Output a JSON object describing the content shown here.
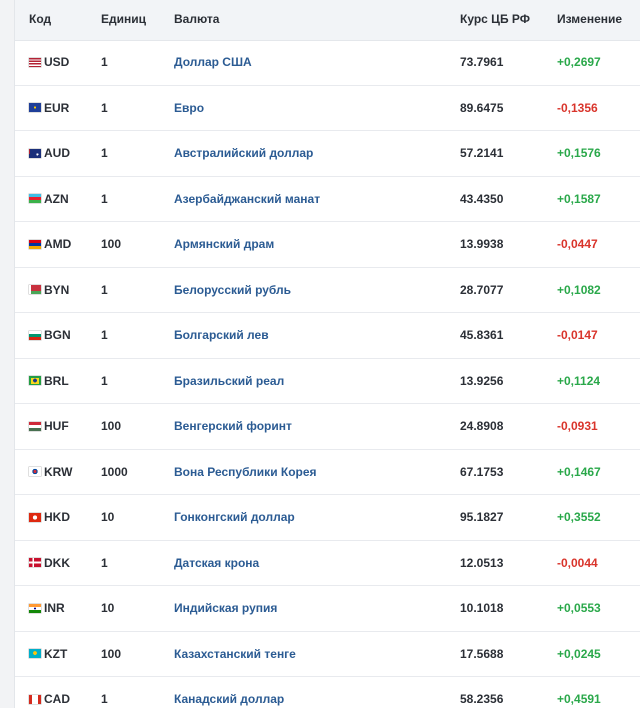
{
  "header": {
    "code": "Код",
    "unit": "Единиц",
    "currency": "Валюта",
    "rate": "Курс ЦБ РФ",
    "change": "Изменение"
  },
  "rows": [
    {
      "code": "USD",
      "unit": "1",
      "name": "Доллар США",
      "rate": "73.7961",
      "change": "+0,2697",
      "direction": "up",
      "flag": "us-flag-icon"
    },
    {
      "code": "EUR",
      "unit": "1",
      "name": "Евро",
      "rate": "89.6475",
      "change": "-0,1356",
      "direction": "down",
      "flag": "eu-flag-icon"
    },
    {
      "code": "AUD",
      "unit": "1",
      "name": "Австралийский доллар",
      "rate": "57.2141",
      "change": "+0,1576",
      "direction": "up",
      "flag": "au-flag-icon"
    },
    {
      "code": "AZN",
      "unit": "1",
      "name": "Азербайджанский манат",
      "rate": "43.4350",
      "change": "+0,1587",
      "direction": "up",
      "flag": "az-flag-icon"
    },
    {
      "code": "AMD",
      "unit": "100",
      "name": "Армянский драм",
      "rate": "13.9938",
      "change": "-0,0447",
      "direction": "down",
      "flag": "am-flag-icon"
    },
    {
      "code": "BYN",
      "unit": "1",
      "name": "Белорусский рубль",
      "rate": "28.7077",
      "change": "+0,1082",
      "direction": "up",
      "flag": "by-flag-icon"
    },
    {
      "code": "BGN",
      "unit": "1",
      "name": "Болгарский лев",
      "rate": "45.8361",
      "change": "-0,0147",
      "direction": "down",
      "flag": "bg-flag-icon"
    },
    {
      "code": "BRL",
      "unit": "1",
      "name": "Бразильский реал",
      "rate": "13.9256",
      "change": "+0,1124",
      "direction": "up",
      "flag": "br-flag-icon"
    },
    {
      "code": "HUF",
      "unit": "100",
      "name": "Венгерский форинт",
      "rate": "24.8908",
      "change": "-0,0931",
      "direction": "down",
      "flag": "hu-flag-icon"
    },
    {
      "code": "KRW",
      "unit": "1000",
      "name": "Вона Республики Корея",
      "rate": "67.1753",
      "change": "+0,1467",
      "direction": "up",
      "flag": "kr-flag-icon"
    },
    {
      "code": "HKD",
      "unit": "10",
      "name": "Гонконгский доллар",
      "rate": "95.1827",
      "change": "+0,3552",
      "direction": "up",
      "flag": "hk-flag-icon"
    },
    {
      "code": "DKK",
      "unit": "1",
      "name": "Датская крона",
      "rate": "12.0513",
      "change": "-0,0044",
      "direction": "down",
      "flag": "dk-flag-icon"
    },
    {
      "code": "INR",
      "unit": "10",
      "name": "Индийская рупия",
      "rate": "10.1018",
      "change": "+0,0553",
      "direction": "up",
      "flag": "in-flag-icon"
    },
    {
      "code": "KZT",
      "unit": "100",
      "name": "Казахстанский тенге",
      "rate": "17.5688",
      "change": "+0,0245",
      "direction": "up",
      "flag": "kz-flag-icon"
    },
    {
      "code": "CAD",
      "unit": "1",
      "name": "Канадский доллар",
      "rate": "58.2356",
      "change": "+0,4591",
      "direction": "up",
      "flag": "ca-flag-icon"
    }
  ],
  "colors": {
    "positive": "#2aa84a",
    "negative": "#d9342b",
    "link": "#2b5b93"
  }
}
